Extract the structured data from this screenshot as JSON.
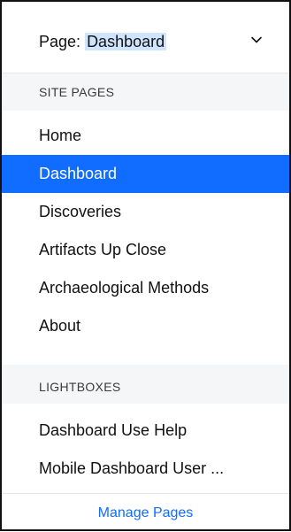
{
  "header": {
    "prefix": "Page:",
    "current_page": "Dashboard",
    "dropdown_icon": "chevron-down-icon"
  },
  "site_pages": {
    "title": "SITE PAGES",
    "items": [
      {
        "label": "Home",
        "selected": false
      },
      {
        "label": "Dashboard",
        "selected": true
      },
      {
        "label": "Discoveries",
        "selected": false
      },
      {
        "label": "Artifacts Up Close",
        "selected": false
      },
      {
        "label": "Archaeological Methods",
        "selected": false
      },
      {
        "label": "About",
        "selected": false
      }
    ]
  },
  "lightboxes": {
    "title": "LIGHTBOXES",
    "items": [
      {
        "label": "Dashboard Use Help"
      },
      {
        "label": "Mobile Dashboard User ..."
      }
    ]
  },
  "footer": {
    "manage_pages_label": "Manage Pages"
  },
  "colors": {
    "accent": "#116dff",
    "selection_highlight": "#cfe5ff",
    "section_background": "#f5f6f8"
  }
}
